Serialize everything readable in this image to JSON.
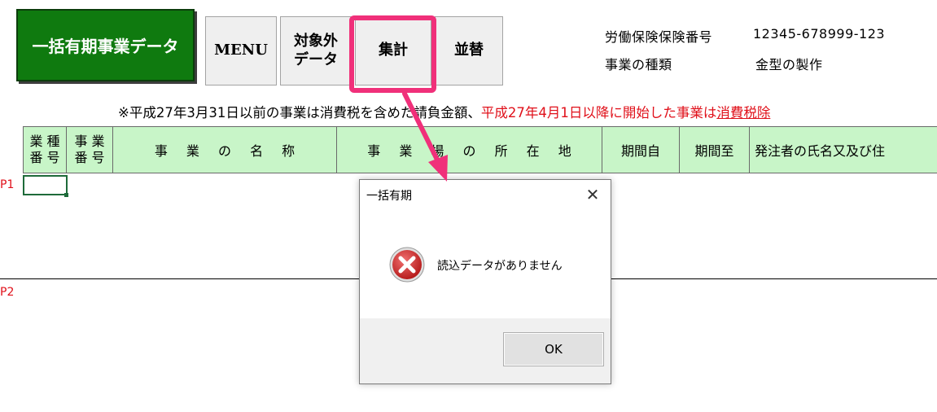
{
  "toolbar": {
    "title": "一括有期事業データ",
    "menu": "MENU",
    "exclude_line1": "対象外",
    "exclude_line2": "データ",
    "aggregate": "集計",
    "sort": "並替"
  },
  "info": {
    "insurance_no_label": "労働保険保険番号",
    "insurance_no_value": "12345-678999-123",
    "business_type_label": "事業の種類",
    "business_type_value": "金型の製作"
  },
  "notice": {
    "part1": "※平成27年3月31日以前の事業は消費税を含めた請負金額、",
    "part2": "平成27年4月1日以降に開始した事業は",
    "part3": "消費税除"
  },
  "table_header": {
    "industry_no_1": "業 種",
    "industry_no_2": "番 号",
    "business_no_1": "事 業",
    "business_no_2": "番 号",
    "business_name": "事 業 の 名 称",
    "site_location": "事 業 場 の 所 在 地",
    "period_from": "期間自",
    "period_to": "期間至",
    "orderer": "発注者の氏名又及び住"
  },
  "rows": {
    "p1": "P1",
    "p2": "P2"
  },
  "dialog": {
    "title": "一括有期",
    "message": "読込データがありません",
    "ok": "OK",
    "close_glyph": "✕"
  },
  "colors": {
    "title_bg": "#0f7a0f",
    "header_bg": "#c8f5c8",
    "highlight": "#f0307a",
    "notice_red": "#e0101a",
    "error_icon": "#c62828"
  }
}
